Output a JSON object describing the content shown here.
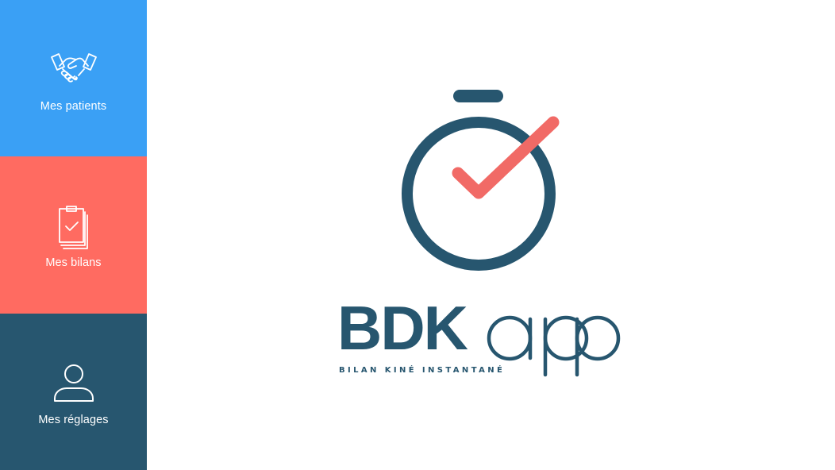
{
  "colors": {
    "patients_bg": "#3aa0f5",
    "bilans_bg": "#ff6b61",
    "reglages_bg": "#27566f",
    "brand_dark": "#27566f",
    "brand_accent": "#f16a66",
    "background": "#ffffff"
  },
  "sidebar": {
    "items": [
      {
        "id": "patients",
        "label": "Mes patients",
        "icon": "handshake-icon"
      },
      {
        "id": "bilans",
        "label": "Mes bilans",
        "icon": "clipboard-check-icon"
      },
      {
        "id": "reglages",
        "label": "Mes réglages",
        "icon": "user-icon"
      }
    ]
  },
  "logo": {
    "wordmark_bold": "BDK",
    "wordmark_light": "app",
    "tagline": "BILAN KINÉ INSTANTANÉ",
    "icon": "stopwatch-check-icon"
  }
}
